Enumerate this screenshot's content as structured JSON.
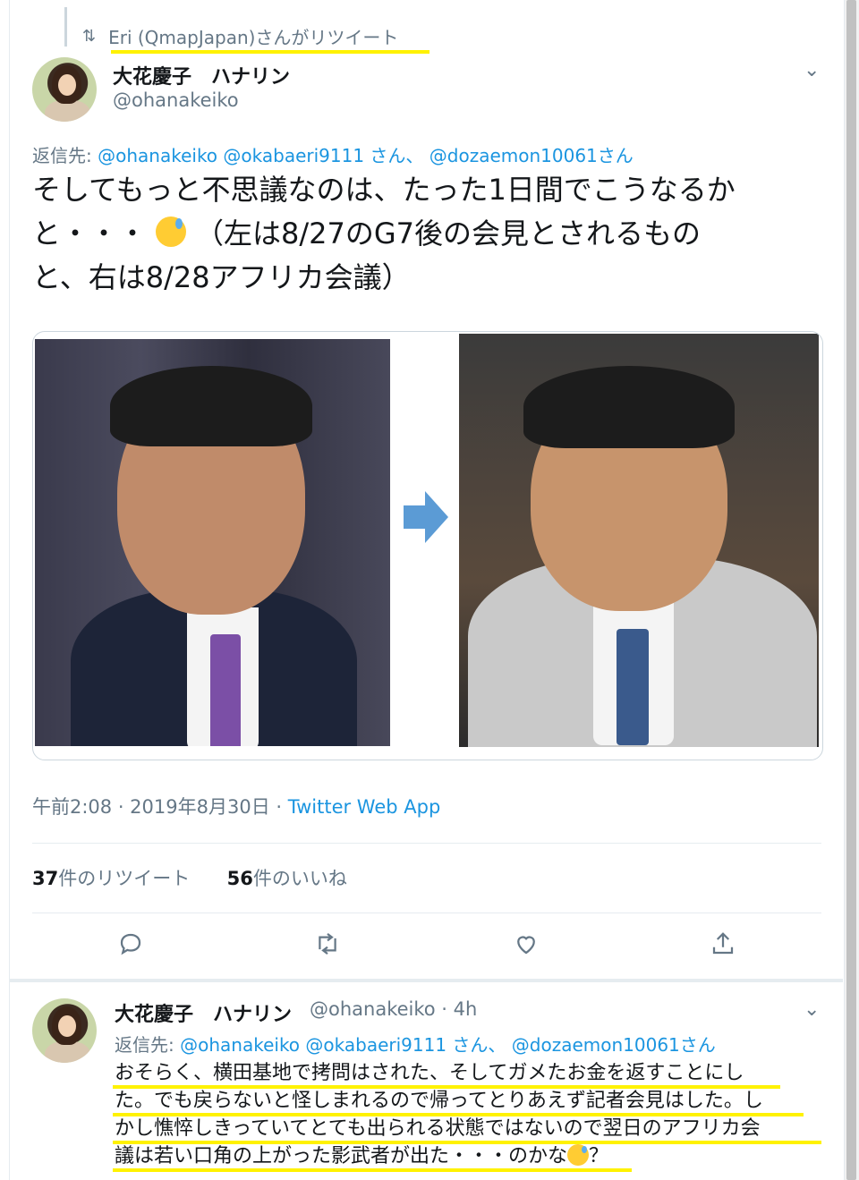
{
  "retweet": {
    "icon": "retweet-icon",
    "label": "Eri (QmapJapan)さんがリツイート"
  },
  "tweet": {
    "author_name": "大花慶子　ハナリン",
    "author_handle": "@ohanakeiko",
    "reply_prefix": "返信先: ",
    "reply_mentions": "@ohanakeiko @okabaeri9111 さん、 @dozaemon10061さん",
    "text_lines": [
      "そしてもっと不思議なのは、たった1日間でこうなるか",
      "と・・・",
      "（左は8/27のG7後の会見とされるもの",
      "と、右は8/28アフリカ会議）"
    ],
    "timestamp": "午前2:08 · 2019年8月30日 · ",
    "source": "Twitter Web App",
    "retweet_count": "37",
    "retweet_label": "件のリツイート",
    "like_count": "56",
    "like_label": "件のいいね"
  },
  "reply": {
    "author_name": "大花慶子　ハナリン",
    "author_handle": "@ohanakeiko · 4h",
    "reply_prefix": "返信先: ",
    "reply_mentions": "@ohanakeiko @okabaeri9111 さん、 @dozaemon10061さん",
    "text_lines": [
      "おそらく、横田基地で拷問はされた、そしてガメたお金を返すことにし",
      "た。でも戻らないと怪しまれるので帰ってとりあえず記者会見はした。し",
      "かし憔悴しきっていてとても出られる状態ではないので翌日のアフリカ会",
      "議は若い口角の上がった影武者が出た・・・のかな",
      "？"
    ]
  },
  "colors": {
    "link": "#1b95e0",
    "secondary": "#657786",
    "highlight": "#fff200"
  }
}
